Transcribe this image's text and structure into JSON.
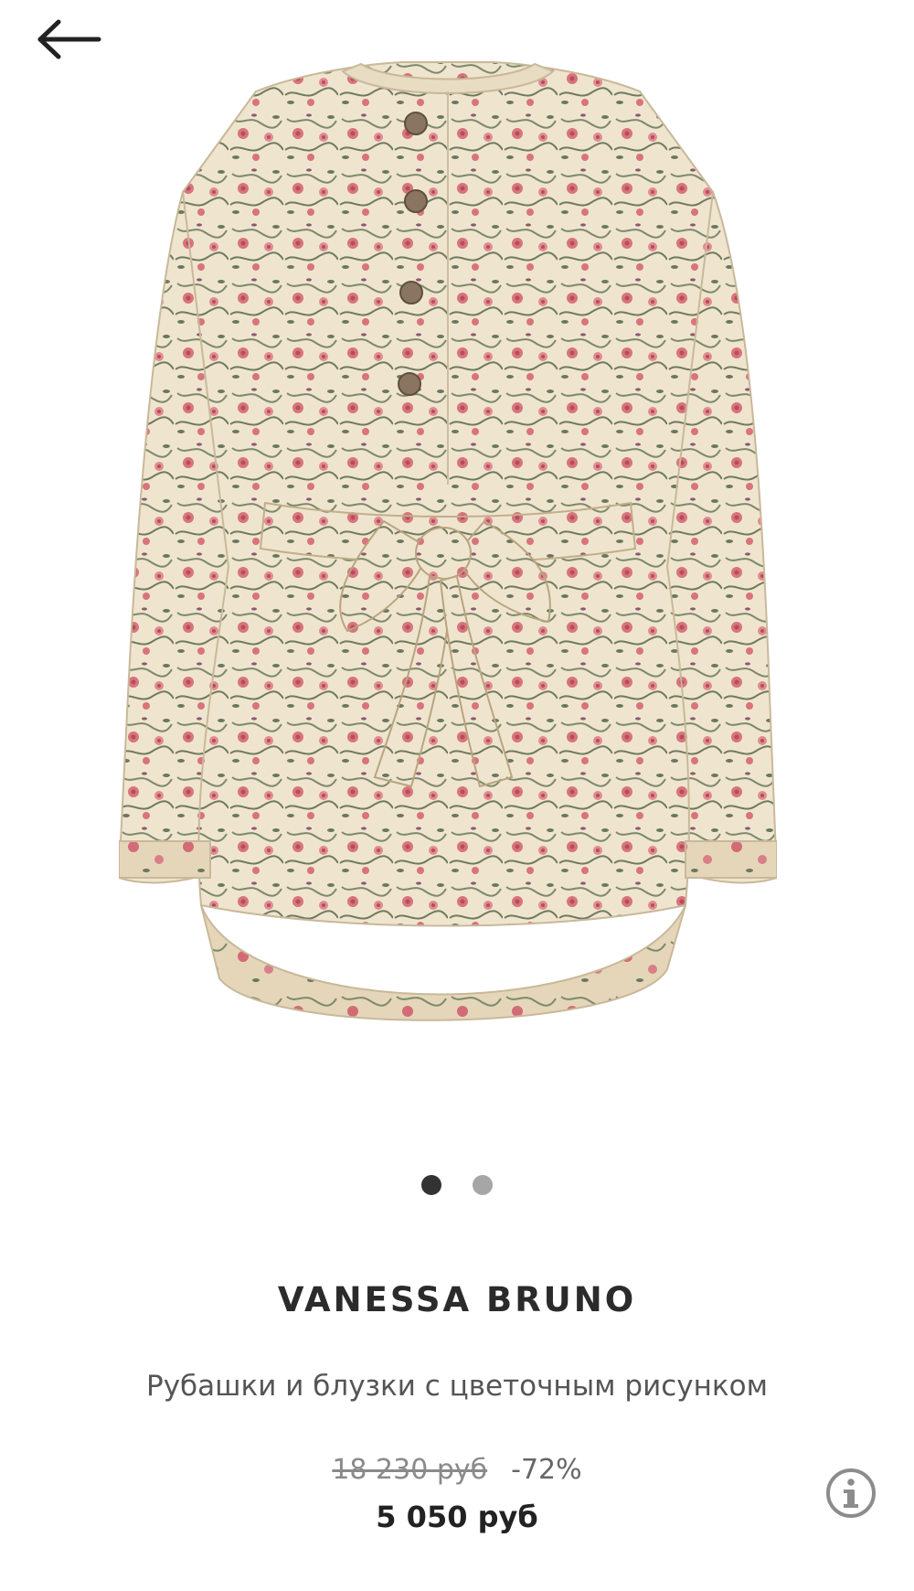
{
  "nav": {
    "back_icon": "arrow-left-icon"
  },
  "gallery": {
    "image_description": "floral-print-blouse",
    "dots": [
      {
        "active": true,
        "color": "#333333"
      },
      {
        "active": false,
        "color": "#a6a6a6"
      }
    ]
  },
  "product": {
    "brand": "VANESSA BRUNO",
    "title": "Рубашки и блузки с цветочным рисунком",
    "old_price": "18 230 руб",
    "discount": "-72%",
    "price": "5 050 руб"
  },
  "info": {
    "icon": "info-icon",
    "color": "#8c8c8c"
  },
  "colors": {
    "fabric": "#efe5cf",
    "flower_pink": "#d9737d",
    "leaf_green": "#7d8a6a",
    "button_brown": "#8a7560"
  }
}
